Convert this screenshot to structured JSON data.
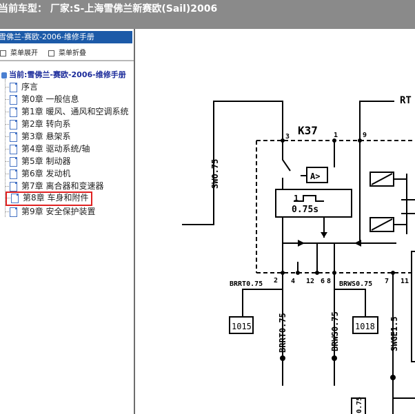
{
  "header": {
    "title": "当前车型： 厂家:S-上海雪佛兰新赛欧(Sail)2006"
  },
  "sidebar": {
    "title": "雪佛兰-赛欧-2006-维修手册",
    "toolbar": {
      "expand_label": "菜单展开",
      "collapse_label": "菜单折叠"
    },
    "root_label": "当前:雪佛兰-赛欧-2006-维修手册",
    "items": [
      {
        "label": "序言"
      },
      {
        "label": "第0章 一般信息"
      },
      {
        "label": "第1章 暖风、通风和空调系统"
      },
      {
        "label": "第2章 转向系"
      },
      {
        "label": "第3章 悬架系"
      },
      {
        "label": "第4章 驱动系统/轴"
      },
      {
        "label": "第5章 制动器"
      },
      {
        "label": "第6章 发动机"
      },
      {
        "label": "第7章 离合器和变速器"
      },
      {
        "label": "第8章 车身和附件"
      },
      {
        "label": "第9章 安全保护装置"
      }
    ],
    "selected_index": 9
  },
  "diagram": {
    "component": "K37",
    "timer": "0.75s",
    "timer_index": "1",
    "amp_label": "A>",
    "top_right_label": "RT",
    "pins": {
      "p3": "3",
      "p1": "1",
      "p9": "9",
      "p2": "2",
      "p4": "4",
      "p12": "12",
      "p8": "8",
      "p6": "6",
      "p7": "7",
      "p11": "11"
    },
    "wires": {
      "swo": "SWO.75",
      "brrt_h": "BRRT0.75",
      "brws_h": "BRWS0.75",
      "brrt_v": "BRRT0.75",
      "brws_v": "BRWS0.75",
      "swge": "SWGE1.5",
      "bottom": "0.75"
    },
    "connectors": {
      "c1015": "1015",
      "c1018": "1018"
    }
  },
  "colors": {
    "accent": "#1c5aa8",
    "selected_border": "#e02020",
    "topbar": "#8a8a8a"
  }
}
